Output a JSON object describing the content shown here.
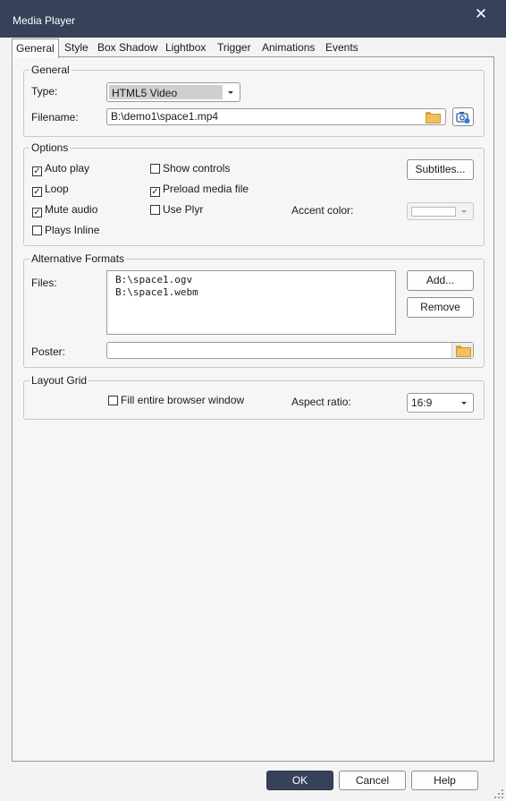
{
  "window": {
    "title": "Media Player",
    "close_glyph": "✕"
  },
  "tabs": [
    {
      "label": "General",
      "active": true
    },
    {
      "label": "Style"
    },
    {
      "label": "Box Shadow"
    },
    {
      "label": "Lightbox"
    },
    {
      "label": "Trigger"
    },
    {
      "label": "Animations"
    },
    {
      "label": "Events"
    }
  ],
  "general": {
    "title": "General",
    "type_label": "Type:",
    "type_value": "HTML5 Video",
    "filename_label": "Filename:",
    "filename_value": "B:\\demo1\\space1.mp4"
  },
  "options": {
    "title": "Options",
    "auto_play": {
      "label": "Auto play",
      "checked": true
    },
    "loop": {
      "label": "Loop",
      "checked": true
    },
    "mute_audio": {
      "label": "Mute audio",
      "checked": true
    },
    "plays_inline": {
      "label": "Plays Inline",
      "checked": false
    },
    "show_controls": {
      "label": "Show controls",
      "checked": false
    },
    "preload_media": {
      "label": "Preload media file",
      "checked": true
    },
    "use_plyr": {
      "label": "Use Plyr",
      "checked": false
    },
    "subtitles_label": "Subtitles...",
    "accent_color_label": "Accent color:",
    "accent_color_value": "#ffffff"
  },
  "alternative_formats": {
    "title": "Alternative Formats",
    "files_label": "Files:",
    "files": [
      "B:\\space1.ogv",
      "B:\\space1.webm"
    ],
    "add_label": "Add...",
    "remove_label": "Remove",
    "poster_label": "Poster:",
    "poster_value": ""
  },
  "layout_grid": {
    "title": "Layout Grid",
    "fill_window": {
      "label": "Fill entire browser window",
      "checked": false
    },
    "aspect_ratio_label": "Aspect ratio:",
    "aspect_ratio_value": "16:9"
  },
  "footer": {
    "ok_label": "OK",
    "cancel_label": "Cancel",
    "help_label": "Help"
  },
  "colors": {
    "titlebar": "#36425a",
    "primary_button": "#36425a",
    "folder": "#efc15a"
  }
}
